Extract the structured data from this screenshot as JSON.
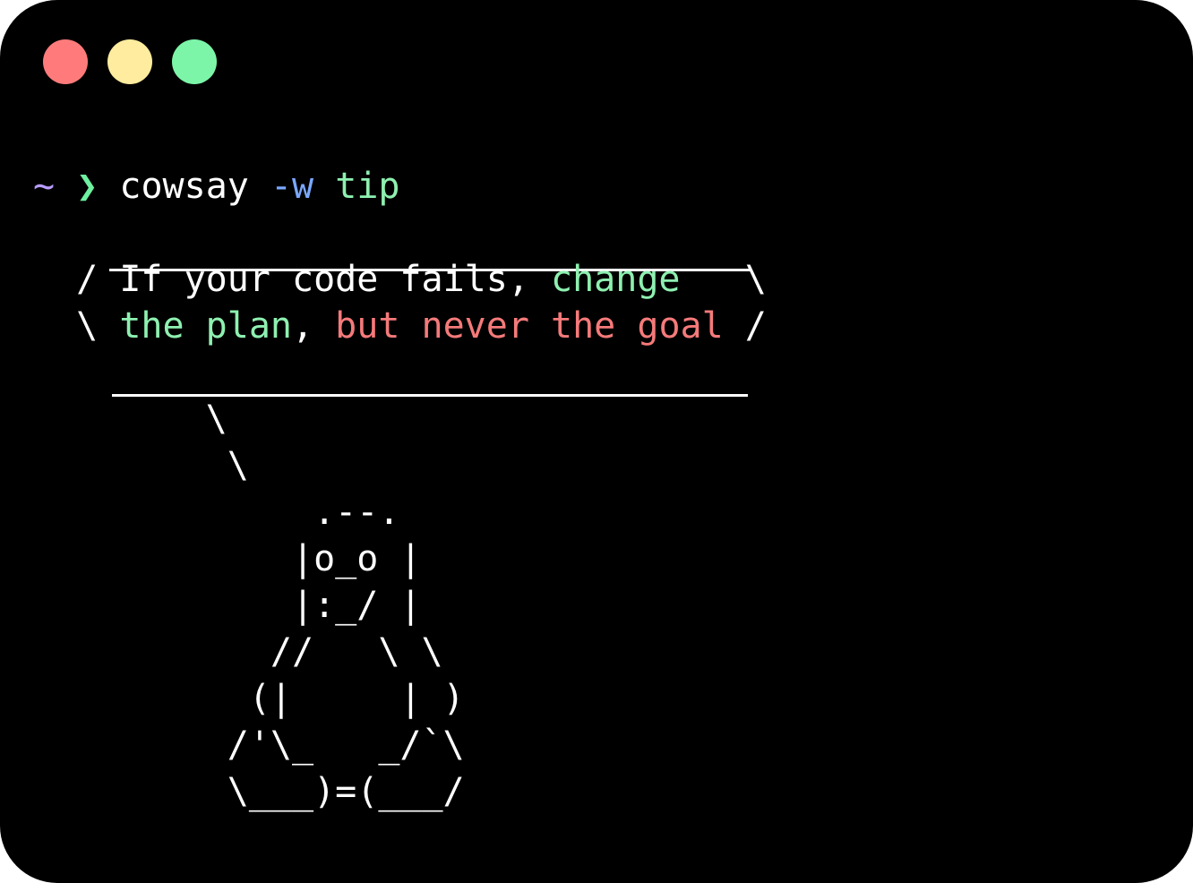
{
  "window": {
    "controls": [
      {
        "name": "close-button",
        "color": "#ff7b7b"
      },
      {
        "name": "minimize-button",
        "color": "#ffec9e"
      },
      {
        "name": "maximize-button",
        "color": "#7cf5a8"
      }
    ]
  },
  "prompt": {
    "tilde": "~",
    "arrow": "❯",
    "command": "cowsay",
    "flag": "-w",
    "argument": "tip"
  },
  "bubble": {
    "line1_open": "/ ",
    "line1_text": "If your code fails, ",
    "line1_green": "change",
    "line1_close": "   \\",
    "line2_open": "\\ ",
    "line2_green1": "the plan",
    "line2_comma": ", ",
    "line2_red1": "but never",
    "line2_space": " ",
    "line2_red2": "the",
    "line2_space2": " ",
    "line2_red3": "goal",
    "line2_close": " /"
  },
  "ascii": {
    "tail1": "        \\",
    "tail2": "         \\",
    "tux1": "             .--.",
    "tux2": "            |o_o |",
    "tux3": "            |:_/ |",
    "tux4": "           //   \\ \\",
    "tux5": "          (|     | )",
    "tux6": "         /'\\_   _/`\\",
    "tux7": "         \\___)=(___/"
  },
  "colors": {
    "background": "#000000",
    "tilde": "#b89cff",
    "arrow": "#6ef0a0",
    "flag": "#7aa8ff",
    "green_text": "#8ef0b0",
    "red_text": "#f57a7a"
  }
}
